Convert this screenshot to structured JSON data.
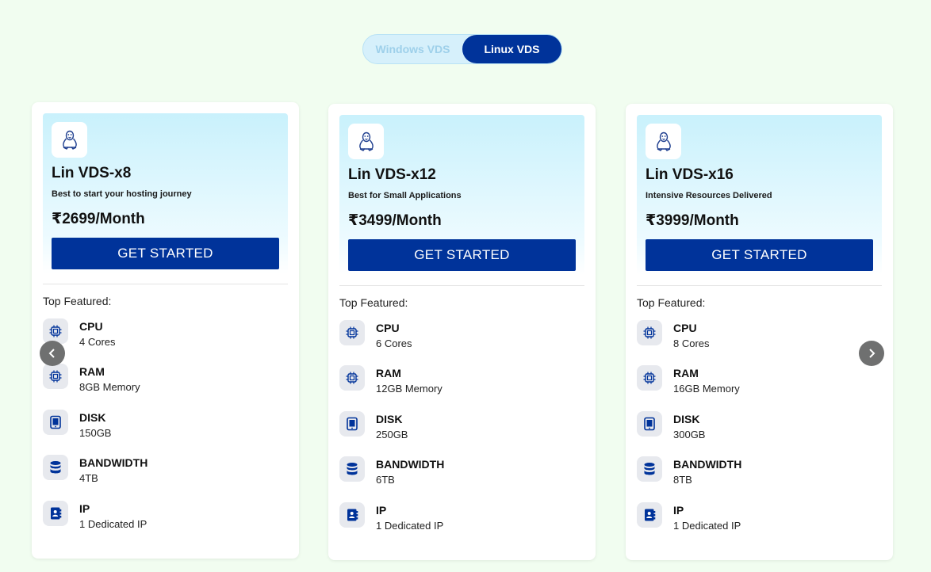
{
  "toggle": {
    "options": [
      "Windows VDS",
      "Linux VDS"
    ],
    "active": "Linux VDS"
  },
  "feature_heading": "Top Featured:",
  "cta_label": "GET STARTED",
  "plans": [
    {
      "name": "Lin VDS-x8",
      "tagline": "Best to start your hosting journey",
      "price": "₹2699/Month",
      "features": [
        {
          "label": "CPU",
          "value": "4 Cores",
          "icon": "cpu-icon"
        },
        {
          "label": "RAM",
          "value": "8GB Memory",
          "icon": "cpu-icon"
        },
        {
          "label": "DISK",
          "value": "150GB",
          "icon": "tablet-icon"
        },
        {
          "label": "BANDWIDTH",
          "value": "4TB",
          "icon": "database-icon"
        },
        {
          "label": "IP",
          "value": "1 Dedicated IP",
          "icon": "contact-book-icon"
        }
      ]
    },
    {
      "name": "Lin VDS-x12",
      "tagline": "Best for Small Applications",
      "price": "₹3499/Month",
      "features": [
        {
          "label": "CPU",
          "value": "6 Cores",
          "icon": "cpu-icon"
        },
        {
          "label": "RAM",
          "value": "12GB Memory",
          "icon": "cpu-icon"
        },
        {
          "label": "DISK",
          "value": "250GB",
          "icon": "tablet-icon"
        },
        {
          "label": "BANDWIDTH",
          "value": "6TB",
          "icon": "database-icon"
        },
        {
          "label": "IP",
          "value": "1 Dedicated IP",
          "icon": "contact-book-icon"
        }
      ]
    },
    {
      "name": "Lin VDS-x16",
      "tagline": "Intensive Resources Delivered",
      "price": "₹3999/Month",
      "features": [
        {
          "label": "CPU",
          "value": "8 Cores",
          "icon": "cpu-icon"
        },
        {
          "label": "RAM",
          "value": "16GB Memory",
          "icon": "cpu-icon"
        },
        {
          "label": "DISK",
          "value": "300GB",
          "icon": "tablet-icon"
        },
        {
          "label": "BANDWIDTH",
          "value": "8TB",
          "icon": "database-icon"
        },
        {
          "label": "IP",
          "value": "1 Dedicated IP",
          "icon": "contact-book-icon"
        }
      ]
    }
  ],
  "colors": {
    "background": "#f1fdf0",
    "brand": "#00339a",
    "toggle_bg": "#d6f0fb",
    "hero_top": "#c9f1fc",
    "arrow": "#6f7070"
  }
}
